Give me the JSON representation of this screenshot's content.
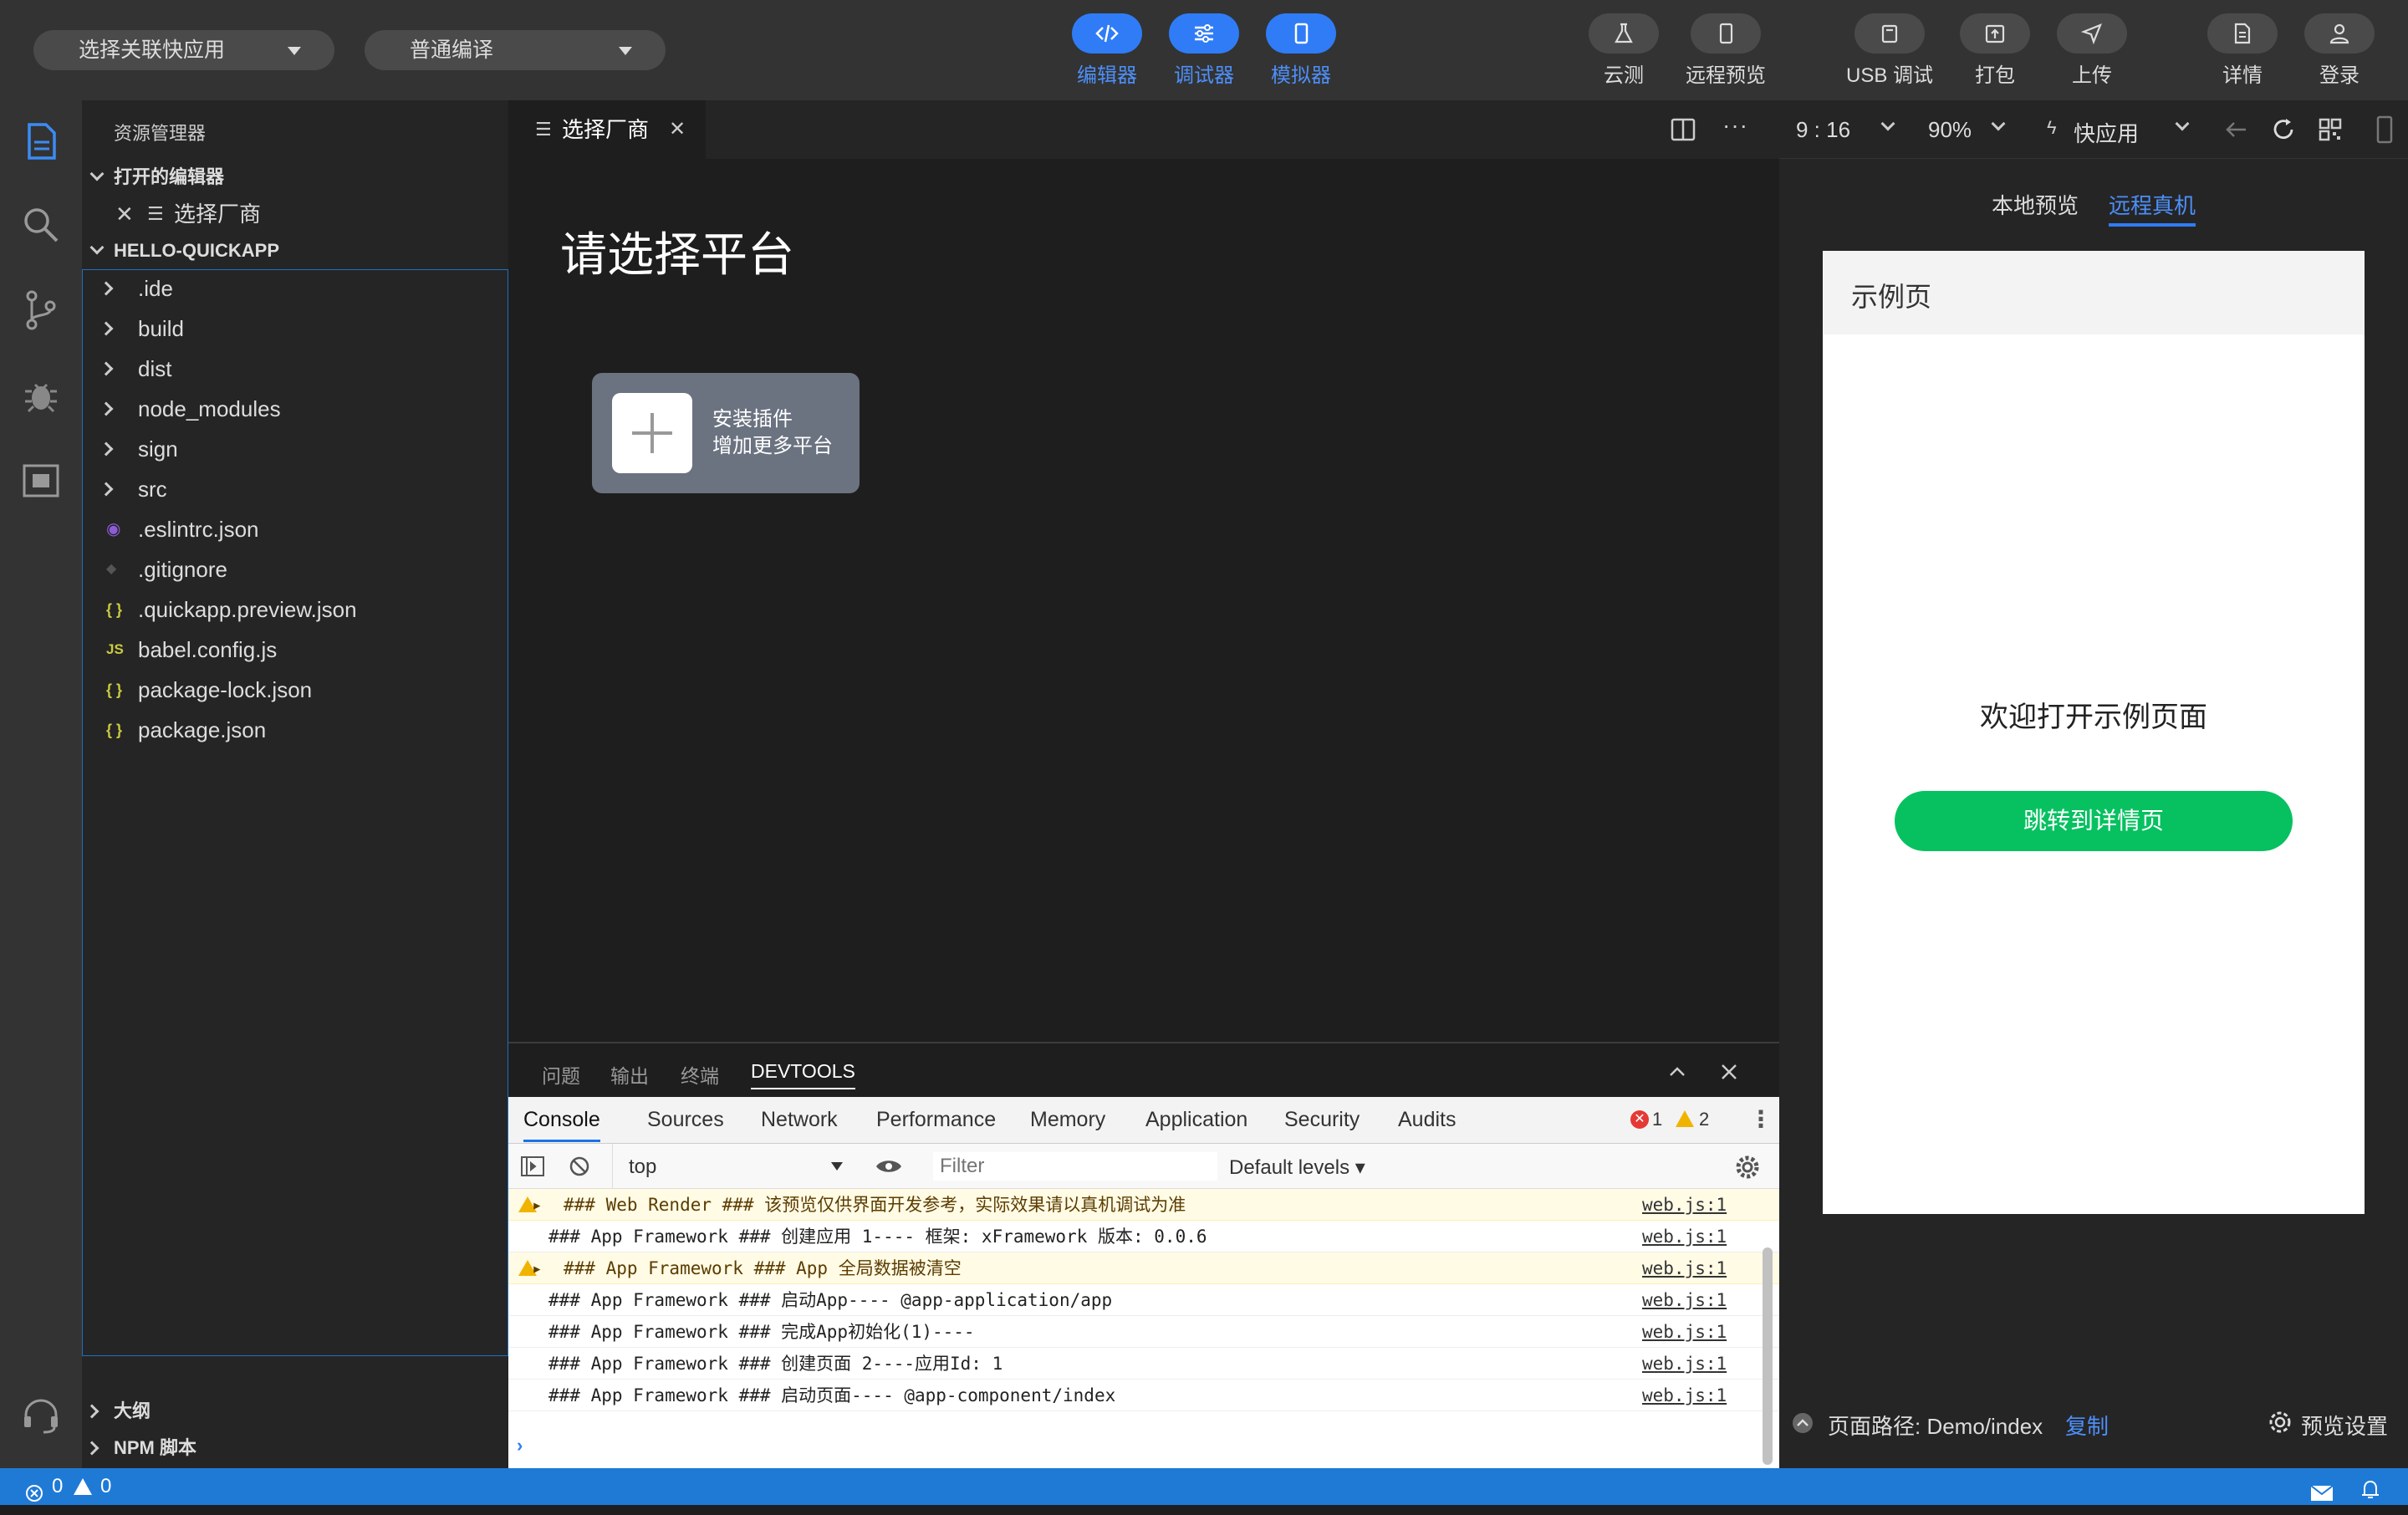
{
  "toolbar": {
    "app_select": "选择关联快应用",
    "compile_select": "普通编译",
    "editor": "编辑器",
    "debugger": "调试器",
    "simulator": "模拟器",
    "cloud_test": "云测",
    "remote_preview": "远程预览",
    "usb_debug": "USB 调试",
    "pack": "打包",
    "upload": "上传",
    "details": "详情",
    "login": "登录"
  },
  "sidebar": {
    "title": "资源管理器",
    "open_editors": "打开的编辑器",
    "open_file": "选择厂商",
    "project": "HELLO-QUICKAPP",
    "items": [
      {
        "name": ".ide",
        "kind": "folder"
      },
      {
        "name": "build",
        "kind": "folder"
      },
      {
        "name": "dist",
        "kind": "folder"
      },
      {
        "name": "node_modules",
        "kind": "folder"
      },
      {
        "name": "sign",
        "kind": "folder"
      },
      {
        "name": "src",
        "kind": "folder"
      },
      {
        "name": ".eslintrc.json",
        "kind": "eslint"
      },
      {
        "name": ".gitignore",
        "kind": "git"
      },
      {
        "name": ".quickapp.preview.json",
        "kind": "json"
      },
      {
        "name": "babel.config.js",
        "kind": "js"
      },
      {
        "name": "package-lock.json",
        "kind": "json"
      },
      {
        "name": "package.json",
        "kind": "json"
      }
    ],
    "outline": "大纲",
    "npm_scripts": "NPM 脚本",
    "json_glyph": "{ }",
    "js_glyph": "JS"
  },
  "editor": {
    "tab_label": "选择厂商",
    "heading": "请选择平台",
    "plugin_line1": "安装插件",
    "plugin_line2": "增加更多平台"
  },
  "preview_toolbar": {
    "ratio": "9 : 16",
    "zoom": "90%",
    "platform": "快应用",
    "more": "···"
  },
  "preview": {
    "tab_local": "本地预览",
    "tab_remote": "远程真机",
    "page_title": "示例页",
    "welcome": "欢迎打开示例页面",
    "button": "跳转到详情页",
    "path_label": "页面路径: Demo/index",
    "copy": "复制",
    "settings": "预览设置"
  },
  "panel": {
    "tabs": [
      "问题",
      "输出",
      "终端",
      "DEVTOOLS"
    ]
  },
  "devtools": {
    "tabs": [
      "Console",
      "Sources",
      "Network",
      "Performance",
      "Memory",
      "Application",
      "Security",
      "Audits"
    ],
    "errors": "1",
    "warnings": "2",
    "context": "top",
    "filter_placeholder": "Filter",
    "levels": "Default levels ▾",
    "logs": [
      {
        "level": "warn",
        "expand": true,
        "msg": "### Web Render ### 该预览仅供界面开发参考，实际效果请以真机调试为准",
        "src": "web.js:1"
      },
      {
        "level": "info",
        "expand": false,
        "msg": "### App Framework ### 创建应用 1---- 框架: xFramework 版本: 0.0.6",
        "src": "web.js:1"
      },
      {
        "level": "warn",
        "expand": true,
        "msg": "### App Framework ### App 全局数据被清空",
        "src": "web.js:1"
      },
      {
        "level": "info",
        "expand": false,
        "msg": "### App Framework ### 启动App---- @app-application/app",
        "src": "web.js:1"
      },
      {
        "level": "info",
        "expand": false,
        "msg": "### App Framework ### 完成App初始化(1)----",
        "src": "web.js:1"
      },
      {
        "level": "info",
        "expand": false,
        "msg": "### App Framework ### 创建页面 2----应用Id: 1",
        "src": "web.js:1"
      },
      {
        "level": "info",
        "expand": false,
        "msg": "### App Framework ### 启动页面---- @app-component/index",
        "src": "web.js:1"
      }
    ]
  },
  "statusbar": {
    "errors": "0",
    "warnings": "0"
  },
  "colors": {
    "accent": "#2f7cf6",
    "green": "#07c160",
    "status": "#1f7ad6"
  }
}
